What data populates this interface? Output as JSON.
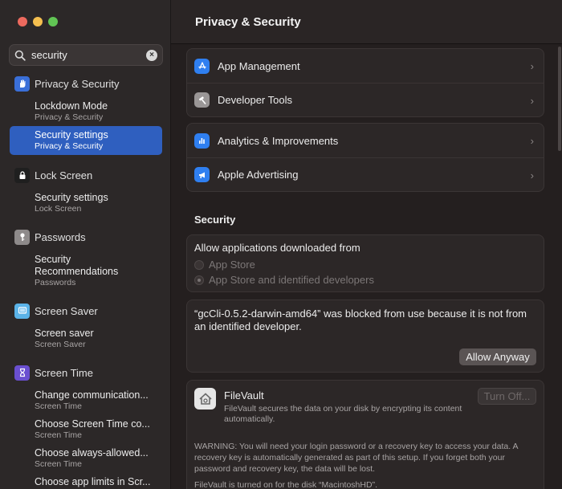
{
  "window": {
    "title": "Privacy & Security"
  },
  "search": {
    "value": "security",
    "placeholder": "Search"
  },
  "sidebar": {
    "sections": [
      {
        "label": "Privacy & Security",
        "icon": "hand-icon",
        "color": "#3a6fd8",
        "items": [
          {
            "title": "Lockdown Mode",
            "subtitle": "Privacy & Security"
          },
          {
            "title": "Security settings",
            "subtitle": "Privacy & Security",
            "selected": true
          }
        ]
      },
      {
        "label": "Lock Screen",
        "icon": "lock-icon",
        "color": "#1f1f1f",
        "items": [
          {
            "title": "Security settings",
            "subtitle": "Lock Screen"
          }
        ]
      },
      {
        "label": "Passwords",
        "icon": "key-icon",
        "color": "#8e8a8a",
        "items": [
          {
            "title": "Security",
            "title2": "Recommendations",
            "subtitle": "Passwords"
          }
        ]
      },
      {
        "label": "Screen Saver",
        "icon": "screen-saver-icon",
        "color": "#5bb3e8",
        "items": [
          {
            "title": "Screen saver",
            "subtitle": "Screen Saver"
          }
        ]
      },
      {
        "label": "Screen Time",
        "icon": "hourglass-icon",
        "color": "#6a4fd0",
        "items": [
          {
            "title": "Change communication...",
            "subtitle": "Screen Time"
          },
          {
            "title": "Choose Screen Time co...",
            "subtitle": "Screen Time"
          },
          {
            "title": "Choose always-allowed...",
            "subtitle": "Screen Time"
          },
          {
            "title": "Choose app limits in Scr...",
            "subtitle": ""
          }
        ]
      }
    ]
  },
  "main": {
    "rows_group1": [
      {
        "label": "App Management",
        "icon": "app-store-icon",
        "color": "#2f7ff0"
      },
      {
        "label": "Developer Tools",
        "icon": "hammer-icon",
        "color": "#9a9696"
      }
    ],
    "rows_group2": [
      {
        "label": "Analytics & Improvements",
        "icon": "analytics-icon",
        "color": "#2f7ff0"
      },
      {
        "label": "Apple Advertising",
        "icon": "megaphone-icon",
        "color": "#2f7ff0"
      }
    ],
    "security_title": "Security",
    "allow": {
      "heading": "Allow applications downloaded from",
      "options": [
        {
          "label": "App Store",
          "checked": false
        },
        {
          "label": "App Store and identified developers",
          "checked": true
        }
      ]
    },
    "blocked": {
      "message": "“gcCli-0.5.2-darwin-amd64” was blocked from use because it is not from an identified developer.",
      "button": "Allow Anyway"
    },
    "filevault": {
      "title": "FileVault",
      "description": "FileVault secures the data on your disk by encrypting its content automatically.",
      "button": "Turn Off...",
      "warning": "WARNING: You will need your login password or a recovery key to access your data. A recovery key is automatically generated as part of this setup. If you forget both your password and recovery key, the data will be lost.",
      "status": "FileVault is turned on for the disk “MacintoshHD”."
    }
  }
}
